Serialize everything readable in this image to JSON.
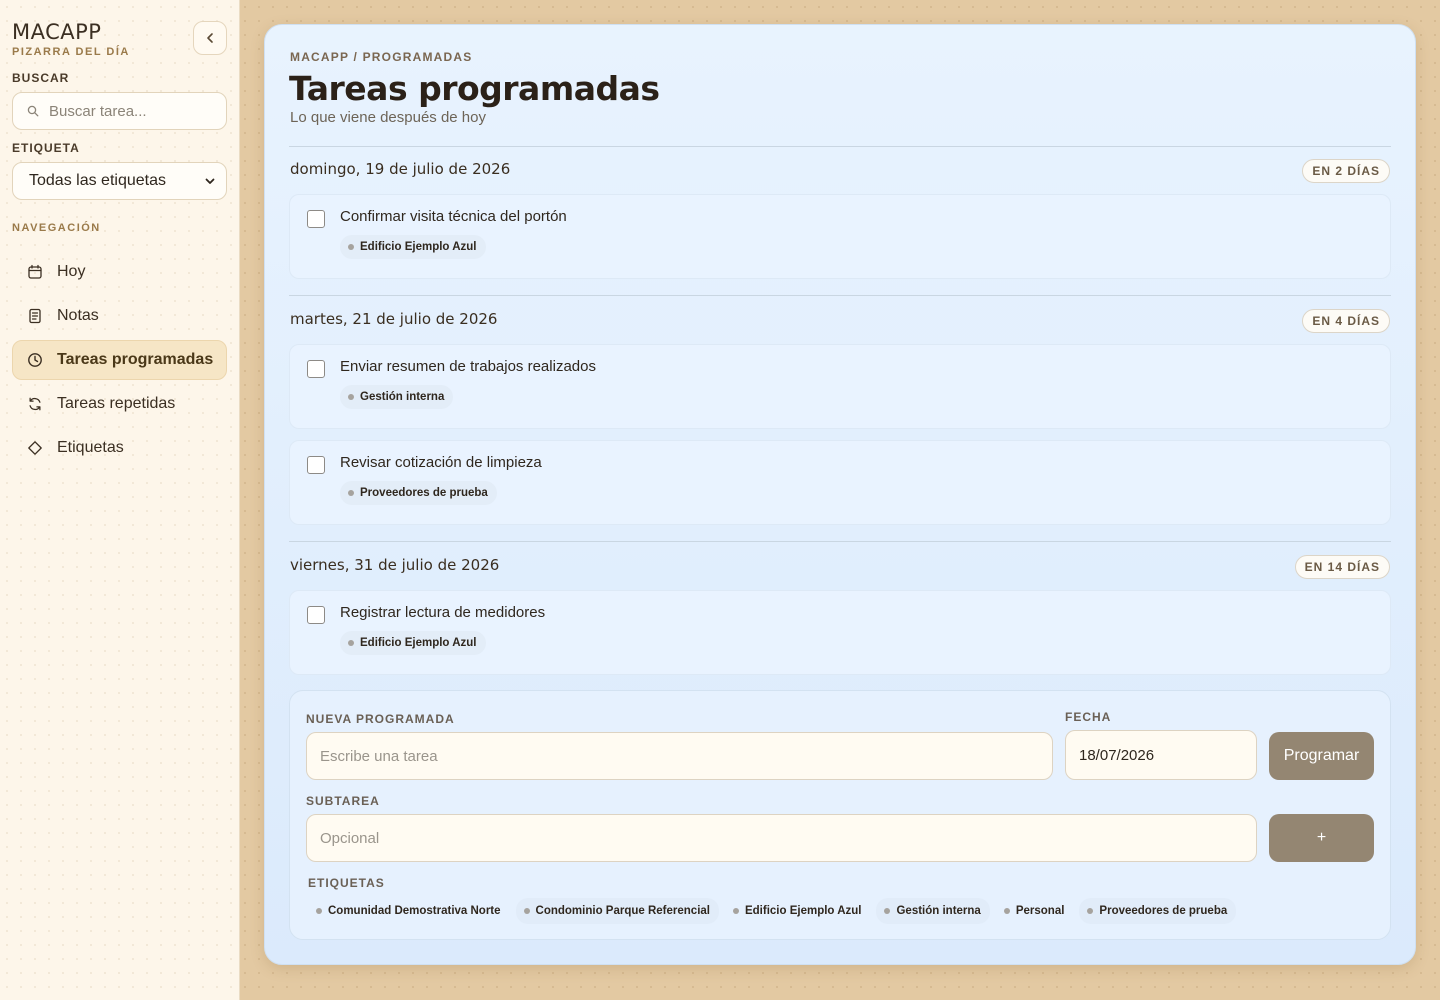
{
  "app": {
    "title": "MACAPP",
    "subtitle": "PIZARRA DEL DÍA"
  },
  "sidebar": {
    "search_label": "BUSCAR",
    "search_placeholder": "Buscar tarea...",
    "tag_label": "ETIQUETA",
    "tag_selected": "Todas las etiquetas",
    "nav_label": "NAVEGACIÓN",
    "items": [
      {
        "label": "Hoy",
        "icon": "calendar-icon"
      },
      {
        "label": "Notas",
        "icon": "note-icon"
      },
      {
        "label": "Tareas programadas",
        "icon": "clock-icon",
        "active": true
      },
      {
        "label": "Tareas repetidas",
        "icon": "refresh-icon"
      },
      {
        "label": "Etiquetas",
        "icon": "tag-icon"
      }
    ]
  },
  "main": {
    "breadcrumb": "MACAPP / PROGRAMADAS",
    "title": "Tareas programadas",
    "subtitle": "Lo que viene después de hoy",
    "groups": [
      {
        "date": "domingo, 19 de julio de 2026",
        "badge": "EN 2 DÍAS",
        "tasks": [
          {
            "title": "Confirmar visita técnica del portón",
            "tag": "Edificio Ejemplo Azul"
          }
        ]
      },
      {
        "date": "martes, 21 de julio de 2026",
        "badge": "EN 4 DÍAS",
        "tasks": [
          {
            "title": "Enviar resumen de trabajos realizados",
            "tag": "Gestión interna"
          },
          {
            "title": "Revisar cotización de limpieza",
            "tag": "Proveedores de prueba"
          }
        ]
      },
      {
        "date": "viernes, 31 de julio de 2026",
        "badge": "EN 14 DÍAS",
        "tasks": [
          {
            "title": "Registrar lectura de medidores",
            "tag": "Edificio Ejemplo Azul"
          }
        ]
      }
    ]
  },
  "form": {
    "task_label": "NUEVA PROGRAMADA",
    "task_placeholder": "Escribe una tarea",
    "date_label": "FECHA",
    "date_value": "18/07/2026",
    "submit_label": "Programar",
    "subtask_label": "SUBTAREA",
    "subtask_placeholder": "Opcional",
    "add_label": "+",
    "tags_label": "ETIQUETAS",
    "tags": [
      "Comunidad Demostrativa Norte",
      "Condominio Parque Referencial",
      "Edificio Ejemplo Azul",
      "Gestión interna",
      "Personal",
      "Proveedores de prueba"
    ]
  },
  "colors": {
    "background": "#e3c9a2",
    "sidebar": "#fdf6ea",
    "card": "#e8f3fe",
    "active_nav": "#f6e6c6",
    "button": "#948672"
  }
}
